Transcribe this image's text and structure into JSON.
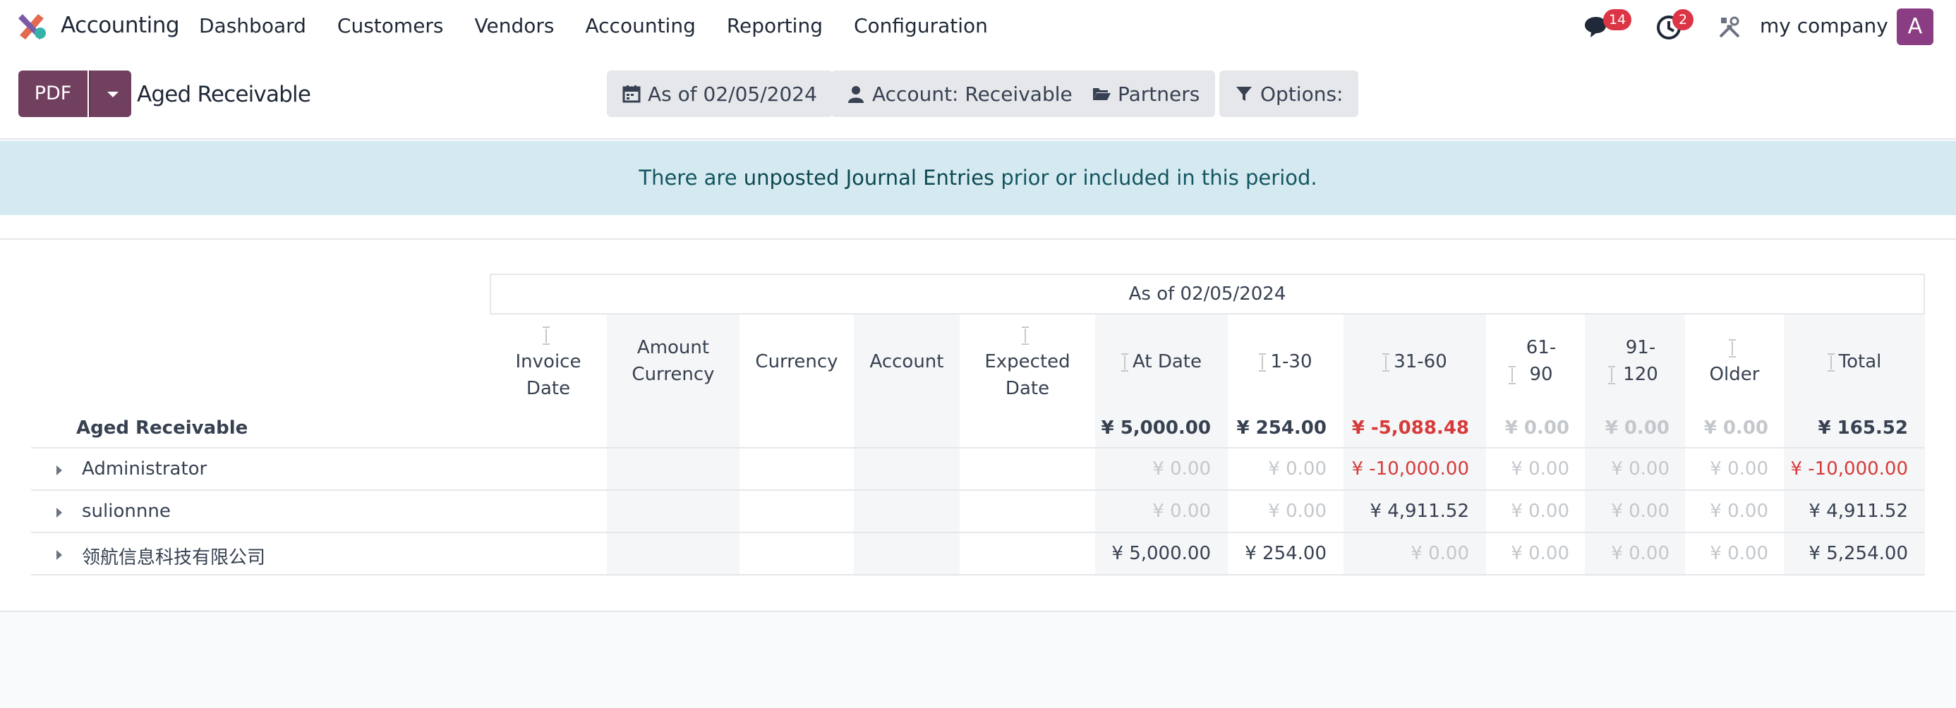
{
  "navbar": {
    "app_name": "Accounting",
    "menu": [
      "Dashboard",
      "Customers",
      "Vendors",
      "Accounting",
      "Reporting",
      "Configuration"
    ],
    "messages_count": "14",
    "activities_count": "2",
    "company": "my company",
    "avatar_letter": "A"
  },
  "control": {
    "pdf_label": "PDF",
    "page_title": "Aged Receivable",
    "filters": {
      "date": "As of 02/05/2024",
      "account": "Account: Receivable",
      "partners": "Partners",
      "options": "Options:"
    }
  },
  "alert": {
    "prefix": "There are ",
    "link": "unposted Journal Entries",
    "suffix": " prior or included in this period."
  },
  "report": {
    "period_header": "As of 02/05/2024",
    "columns": {
      "invoice_date": "Invoice Date",
      "amount_currency": "Amount Currency",
      "currency": "Currency",
      "account": "Account",
      "expected_date": "Expected Date",
      "at_date": "At Date",
      "b1_30": "1-30",
      "b31_60": "31-60",
      "b61_90": "61-90",
      "b91_120": "91-120",
      "older": "Older",
      "total": "Total"
    },
    "total_row": {
      "label": "Aged Receivable",
      "at_date": "¥ 5,000.00",
      "b1_30": "¥ 254.00",
      "b31_60": "¥ -5,088.48",
      "b61_90": "¥ 0.00",
      "b91_120": "¥ 0.00",
      "older": "¥ 0.00",
      "total": "¥ 165.52"
    },
    "rows": [
      {
        "label": "Administrator",
        "at_date": "¥ 0.00",
        "b1_30": "¥ 0.00",
        "b31_60": "¥ -10,000.00",
        "b61_90": "¥ 0.00",
        "b91_120": "¥ 0.00",
        "older": "¥ 0.00",
        "total": "¥ -10,000.00"
      },
      {
        "label": "sulionnne",
        "at_date": "¥ 0.00",
        "b1_30": "¥ 0.00",
        "b31_60": "¥ 4,911.52",
        "b61_90": "¥ 0.00",
        "b91_120": "¥ 0.00",
        "older": "¥ 0.00",
        "total": "¥ 4,911.52"
      },
      {
        "label": "领航信息科技有限公司",
        "at_date": "¥ 5,000.00",
        "b1_30": "¥ 254.00",
        "b31_60": "¥ 0.00",
        "b61_90": "¥ 0.00",
        "b91_120": "¥ 0.00",
        "older": "¥ 0.00",
        "total": "¥ 5,254.00"
      }
    ]
  },
  "colors": {
    "brand": "#71405f",
    "negative": "#d63b3b",
    "alert_bg": "#d4eaf0",
    "badge": "#dc3545"
  }
}
